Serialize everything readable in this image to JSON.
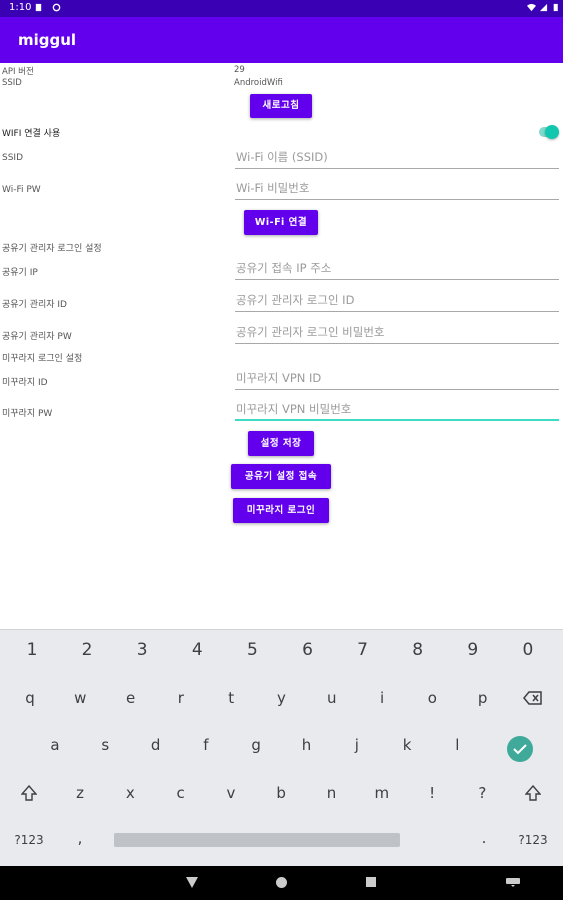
{
  "status_bar": {
    "time": "1:10"
  },
  "app_bar": {
    "title": "miggul"
  },
  "info": {
    "api_label": "API 버전",
    "api_value": "29",
    "ssid_label": "SSID",
    "ssid_value": "AndroidWifi",
    "refresh_button": "새로고침"
  },
  "wifi": {
    "use_label": "WIFI 연결 사용",
    "toggle_on": true,
    "ssid_label": "SSID",
    "ssid_placeholder": "Wi-Fi 이름 (SSID)",
    "pw_label": "Wi-Fi PW",
    "pw_placeholder": "Wi-Fi 비밀번호",
    "connect_button": "Wi-Fi 연결"
  },
  "router": {
    "section_title": "공유기 관리자 로그인 설정",
    "ip_label": "공유기 IP",
    "ip_placeholder": "공유기 접속 IP 주소",
    "id_label": "공유기 관리자 ID",
    "id_placeholder": "공유기 관리자 로그인 ID",
    "pw_label": "공유기 관리자 PW",
    "pw_placeholder": "공유기 관리자 로그인 비밀번호"
  },
  "miggurage": {
    "section_title": "미꾸라지 로그인 설정",
    "id_label": "미꾸라지 ID",
    "id_placeholder": "미꾸라지 VPN ID",
    "pw_label": "미꾸라지 PW",
    "pw_placeholder": "미꾸라지 VPN 비밀번호"
  },
  "actions": {
    "save_button": "설정 저장",
    "router_connect_button": "공유기 설정 접속",
    "login_button": "미꾸라지 로그인"
  },
  "keyboard": {
    "row1": [
      "1",
      "2",
      "3",
      "4",
      "5",
      "6",
      "7",
      "8",
      "9",
      "0"
    ],
    "row2": [
      "q",
      "w",
      "e",
      "r",
      "t",
      "y",
      "u",
      "i",
      "o",
      "p"
    ],
    "row3": [
      "a",
      "s",
      "d",
      "f",
      "g",
      "h",
      "j",
      "k",
      "l"
    ],
    "row4": [
      "z",
      "x",
      "c",
      "v",
      "b",
      "n",
      "m",
      "!",
      "?"
    ],
    "sym_left": "?123",
    "comma": ",",
    "period": ".",
    "sym_right": "?123"
  },
  "colors": {
    "primary": "#6200ee",
    "status_bar": "#3a00b3",
    "accent": "#12c7b0"
  }
}
